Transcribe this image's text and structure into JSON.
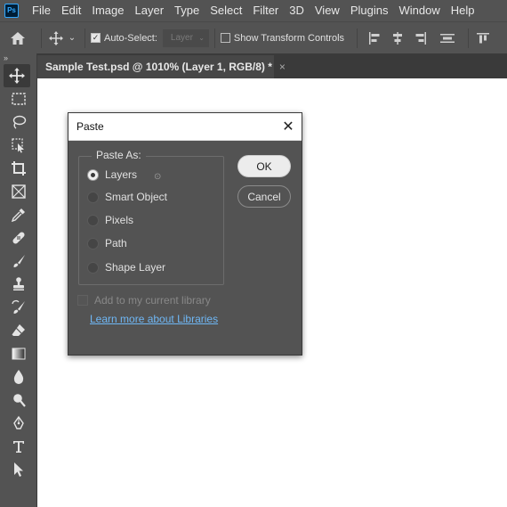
{
  "app": {
    "logo_text": "Ps",
    "accent": "#31a8ff"
  },
  "menu": [
    "File",
    "Edit",
    "Image",
    "Layer",
    "Type",
    "Select",
    "Filter",
    "3D",
    "View",
    "Plugins",
    "Window",
    "Help"
  ],
  "options_bar": {
    "auto_select_label": "Auto-Select:",
    "auto_select_checked": true,
    "layer_select_value": "Layer",
    "show_transform_label": "Show Transform Controls",
    "show_transform_checked": false
  },
  "document_tab": {
    "title": "Sample Test.psd @ 1010% (Layer 1, RGB/8) *",
    "close_glyph": "×"
  },
  "toolbar": {
    "collapse_glyph": "»",
    "tools": [
      "move-tool",
      "marquee-tool",
      "lasso-tool",
      "object-select-tool",
      "crop-tool",
      "frame-tool",
      "eyedropper-tool",
      "healing-brush-tool",
      "brush-tool",
      "clone-stamp-tool",
      "history-brush-tool",
      "eraser-tool",
      "gradient-tool",
      "blur-tool",
      "dodge-tool",
      "pen-tool",
      "type-tool",
      "path-select-tool"
    ]
  },
  "dialog": {
    "title": "Paste",
    "close_glyph": "✕",
    "group_label": "Paste As:",
    "options": [
      {
        "label": "Layers",
        "selected": true
      },
      {
        "label": "Smart Object",
        "selected": false
      },
      {
        "label": "Pixels",
        "selected": false
      },
      {
        "label": "Path",
        "selected": false
      },
      {
        "label": "Shape Layer",
        "selected": false
      }
    ],
    "ok_label": "OK",
    "cancel_label": "Cancel",
    "library_label": "Add to my current library",
    "library_checked": false,
    "learn_link": "Learn more about Libraries"
  }
}
